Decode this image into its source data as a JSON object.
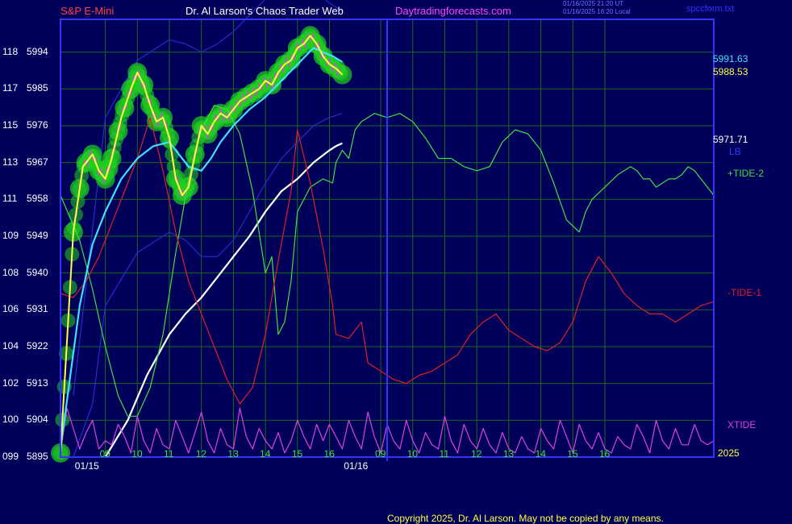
{
  "header": {
    "symbol": "S&P E-Mini",
    "title": "Dr. Al Larson's Chaos Trader Web",
    "site": "Daytradingforecasts.com",
    "time_utc": "01/16/2025 21:20 UT",
    "time_local": "01/16/2025 16:20 Local",
    "file": "spccform.txt"
  },
  "right_labels": {
    "price_blue": "5991.63",
    "price_yellow": "5988.53",
    "price_white": "5971.71",
    "lb": "LB",
    "tide2": "+TIDE-2",
    "tide1": "-TIDE-1",
    "xtide": "XTIDE",
    "year": "2025"
  },
  "footer": {
    "copyright": "Copyright 2025, Dr. Al Larson. May not be copied by any means."
  },
  "colors": {
    "background": "#00005a",
    "grid": "#1a6a1a",
    "border": "#3434ff",
    "price": "#ffff40",
    "fast_avg": "#40e0ff",
    "white_line": "#ffffff",
    "tide_plus": "#40e040",
    "tide_minus": "#e02020",
    "xtide": "#e040e0",
    "glow": "#20d020",
    "channel": "#2a2ad0"
  },
  "chart_data": {
    "type": "line",
    "y_axis": {
      "left_ticks": [
        "099",
        "100",
        "102",
        "104",
        "106",
        "108",
        "109",
        "111",
        "113",
        "115",
        "117",
        "118"
      ],
      "price_ticks": [
        5895,
        5904,
        5913,
        5922,
        5931,
        5940,
        5949,
        5958,
        5967,
        5976,
        5985,
        5994
      ],
      "ylim": [
        5895,
        6002
      ]
    },
    "x_axis": {
      "ticks": [
        "09",
        "10",
        "11",
        "12",
        "13",
        "14",
        "15",
        "16",
        "09",
        "10",
        "11",
        "12",
        "13",
        "14",
        "15",
        "16"
      ],
      "dates": [
        "01/15",
        "01/16"
      ]
    },
    "series": [
      {
        "name": "LB",
        "color": "#ffffff",
        "x": [
          9.0,
          9.7,
          10.3,
          11.0,
          11.5,
          12.0,
          12.5,
          13.0,
          13.5,
          14.0,
          14.5,
          15.0,
          15.5,
          16.0,
          16.2,
          16.4
        ],
        "y": [
          5895,
          5904,
          5915,
          5925,
          5930,
          5934,
          5939,
          5944,
          5949,
          5955,
          5960,
          5963,
          5967,
          5970,
          5971.0,
          5971.7
        ]
      },
      {
        "name": "",
        "color": "#40e0ff",
        "x": [
          7.6,
          8.2,
          8.6,
          9.0,
          9.5,
          10.0,
          10.5,
          11.0,
          11.3,
          11.6,
          12.0,
          12.3,
          12.6,
          13.0,
          13.5,
          14.0,
          14.5,
          15.0,
          15.5,
          15.8,
          16.1,
          16.4
        ],
        "y": [
          5897,
          5932,
          5947,
          5955,
          5963,
          5968,
          5971,
          5972,
          5969,
          5966,
          5965,
          5968,
          5972,
          5976,
          5980,
          5983,
          5987,
          5991,
          5995,
          5994,
          5993,
          5991.6
        ]
      },
      {
        "name": "",
        "color": "#ffff40",
        "x": [
          7.6,
          8.0,
          8.3,
          8.6,
          8.8,
          9.0,
          9.2,
          9.5,
          9.8,
          10.0,
          10.2,
          10.4,
          10.6,
          10.8,
          11.0,
          11.2,
          11.4,
          11.6,
          11.8,
          12.0,
          12.2,
          12.4,
          12.6,
          12.8,
          13.0,
          13.2,
          13.4,
          13.6,
          13.8,
          14.0,
          14.2,
          14.4,
          14.6,
          14.8,
          15.0,
          15.2,
          15.4,
          15.6,
          15.8,
          16.0,
          16.2,
          16.4
        ],
        "y": [
          5896,
          5950,
          5966,
          5969,
          5965,
          5963,
          5968,
          5978,
          5985,
          5989,
          5986,
          5981,
          5977,
          5978,
          5973,
          5963,
          5959,
          5961,
          5969,
          5976,
          5974,
          5977,
          5979,
          5978,
          5980,
          5982,
          5983,
          5984,
          5985,
          5987,
          5986,
          5989,
          5991,
          5992,
          5995,
          5996,
          5998,
          5996,
          5993,
          5991,
          5990,
          5988.5
        ]
      },
      {
        "name": "+TIDE-2",
        "color": "#40e040",
        "x": [
          7.6,
          8.2,
          8.6,
          9.0,
          9.4,
          9.7,
          10.0,
          10.4,
          10.8,
          11.2,
          11.6,
          12.0,
          12.4,
          12.8,
          13.2,
          13.6,
          14.0,
          14.2,
          14.4,
          14.6,
          14.8,
          15.0,
          15.4,
          15.8,
          16.1,
          16.2,
          16.4,
          16.6,
          16.8,
          17.0,
          17.4,
          17.8,
          18.2,
          18.6,
          19.0,
          19.4,
          19.8,
          20.2,
          20.6,
          21.0,
          21.4,
          21.8,
          22.2,
          22.6,
          23.0,
          23.4,
          23.8,
          24.0,
          24.2,
          24.6,
          25.0,
          25.4,
          25.6,
          25.8,
          26.0,
          26.2,
          26.4,
          26.6,
          26.8,
          27.0,
          27.2,
          27.4,
          27.6,
          27.8,
          28.0
        ],
        "y": [
          5959,
          5948,
          5936,
          5922,
          5910,
          5905,
          5905,
          5912,
          5925,
          5945,
          5963,
          5975,
          5981,
          5980,
          5974,
          5960,
          5940,
          5944,
          5925,
          5928,
          5938,
          5955,
          5961,
          5963,
          5962,
          5967,
          5970,
          5968,
          5975,
          5977,
          5979,
          5978,
          5979,
          5977,
          5973,
          5968,
          5968,
          5966,
          5965,
          5966,
          5972,
          5975,
          5974,
          5970,
          5962,
          5953,
          5950,
          5955,
          5958,
          5961,
          5964,
          5966,
          5965,
          5963,
          5963,
          5961,
          5962,
          5963,
          5963,
          5964,
          5966,
          5965,
          5963,
          5961,
          5959
        ]
      },
      {
        "name": "-TIDE-1",
        "color": "#e02020",
        "x": [
          7.6,
          8.0,
          8.4,
          8.8,
          9.2,
          9.6,
          10.0,
          10.4,
          10.8,
          11.2,
          11.6,
          12.0,
          12.4,
          12.8,
          13.2,
          13.6,
          14.0,
          14.4,
          14.8,
          15.0,
          15.4,
          15.8,
          16.1,
          16.2,
          16.6,
          17.0,
          17.2,
          17.6,
          18.0,
          18.4,
          18.8,
          19.2,
          19.6,
          20.0,
          20.4,
          20.8,
          21.2,
          21.6,
          22.0,
          22.4,
          22.8,
          23.2,
          23.6,
          24.0,
          24.4,
          24.8,
          25.2,
          25.6,
          26.0,
          26.4,
          26.8,
          27.2,
          27.6,
          28.0
        ],
        "y": [
          5935,
          5934,
          5938,
          5944,
          5952,
          5960,
          5968,
          5978,
          5965,
          5950,
          5938,
          5930,
          5922,
          5914,
          5908,
          5912,
          5925,
          5943,
          5960,
          5975,
          5962,
          5946,
          5932,
          5925,
          5924,
          5928,
          5918,
          5916,
          5914,
          5913,
          5915,
          5916,
          5918,
          5920,
          5925,
          5928,
          5930,
          5926,
          5924,
          5922,
          5921,
          5923,
          5928,
          5938,
          5944,
          5940,
          5935,
          5932,
          5930,
          5930,
          5928,
          5930,
          5932,
          5933
        ]
      },
      {
        "name": "XTIDE",
        "color": "#e040e0",
        "x": [
          7.6,
          7.8,
          8.0,
          8.2,
          8.4,
          8.6,
          8.8,
          9.0,
          9.2,
          9.4,
          9.6,
          9.8,
          10.0,
          10.2,
          10.4,
          10.6,
          10.8,
          11.0,
          11.2,
          11.4,
          11.6,
          11.8,
          12.0,
          12.2,
          12.4,
          12.6,
          12.8,
          13.0,
          13.2,
          13.4,
          13.6,
          13.8,
          14.0,
          14.2,
          14.4,
          14.6,
          14.8,
          15.0,
          15.2,
          15.4,
          15.6,
          15.8,
          16.0,
          16.2,
          16.4,
          16.6,
          16.8,
          17.0,
          17.2,
          17.4,
          17.6,
          17.8,
          18.0,
          18.2,
          18.4,
          18.6,
          18.8,
          19.0,
          19.2,
          19.4,
          19.6,
          19.8,
          20.0,
          20.2,
          20.4,
          20.6,
          20.8,
          21.0,
          21.2,
          21.4,
          21.6,
          21.8,
          22.0,
          22.2,
          22.4,
          22.6,
          22.8,
          23.0,
          23.2,
          23.4,
          23.6,
          23.8,
          24.0,
          24.2,
          24.4,
          24.6,
          24.8,
          25.0,
          25.2,
          25.4,
          25.6,
          25.8,
          26.0,
          26.2,
          26.4,
          26.6,
          26.8,
          27.0,
          27.2,
          27.4,
          27.6,
          27.8,
          28.0
        ],
        "y": [
          5896,
          5907,
          5902,
          5897,
          5901,
          5904,
          5897,
          5899,
          5898,
          5903,
          5900,
          5896,
          5905,
          5899,
          5896,
          5902,
          5898,
          5897,
          5904,
          5900,
          5896,
          5901,
          5906,
          5899,
          5896,
          5902,
          5898,
          5897,
          5907,
          5900,
          5897,
          5902,
          5899,
          5897,
          5901,
          5896,
          5899,
          5904,
          5900,
          5897,
          5903,
          5899,
          5903,
          5900,
          5897,
          5904,
          5900,
          5897,
          5906,
          5900,
          5896,
          5903,
          5899,
          5897,
          5904,
          5899,
          5896,
          5901,
          5898,
          5897,
          5905,
          5899,
          5896,
          5903,
          5899,
          5897,
          5902,
          5898,
          5896,
          5901,
          5897,
          5896,
          5900,
          5897,
          5896,
          5902,
          5899,
          5897,
          5904,
          5900,
          5896,
          5903,
          5899,
          5897,
          5901,
          5897,
          5896,
          5900,
          5898,
          5897,
          5903,
          5900,
          5896,
          5904,
          5899,
          5897,
          5902,
          5898,
          5898,
          5903,
          5899,
          5898,
          5899
        ]
      },
      {
        "name": "",
        "color": "#2a2ad0",
        "x": [
          8.0,
          9.0,
          10.0,
          11.0,
          11.5,
          12.0,
          12.5,
          13.0,
          13.5,
          14.0,
          14.5,
          15.0,
          15.5,
          16.0,
          16.4
        ],
        "y": [
          5910,
          5978,
          5992,
          5997,
          5996,
          5994,
          5996,
          5999,
          6003,
          6007,
          6009,
          6010,
          6009,
          6006,
          6004
        ]
      },
      {
        "name": "",
        "color": "#2a2ad0",
        "x": [
          8.0,
          8.6,
          9.0,
          10.0,
          11.0,
          11.5,
          12.0,
          12.5,
          13.0,
          13.5,
          14.0,
          14.5,
          15.0,
          15.5,
          16.0,
          16.4
        ],
        "y": [
          5895,
          5908,
          5932,
          5945,
          5950,
          5948,
          5944,
          5944,
          5948,
          5955,
          5962,
          5968,
          5972,
          5976,
          5978,
          5979
        ]
      }
    ],
    "glow": {
      "color": "#20d020",
      "series": "price",
      "points_x": [
        7.6,
        8.0,
        8.2,
        8.4,
        8.6,
        8.8,
        9.0,
        9.1,
        9.2,
        9.4,
        9.6,
        9.8,
        10.0,
        10.2,
        10.4,
        10.6,
        10.8,
        11.0,
        11.2,
        11.4,
        11.6,
        11.8,
        12.0,
        12.2,
        12.4,
        12.6,
        12.8,
        13.0,
        13.2,
        13.4,
        13.6,
        13.8,
        14.0,
        14.2,
        14.4,
        14.6,
        14.8,
        15.0,
        15.2,
        15.4,
        15.6,
        15.8,
        16.0,
        16.2,
        16.4
      ]
    }
  }
}
